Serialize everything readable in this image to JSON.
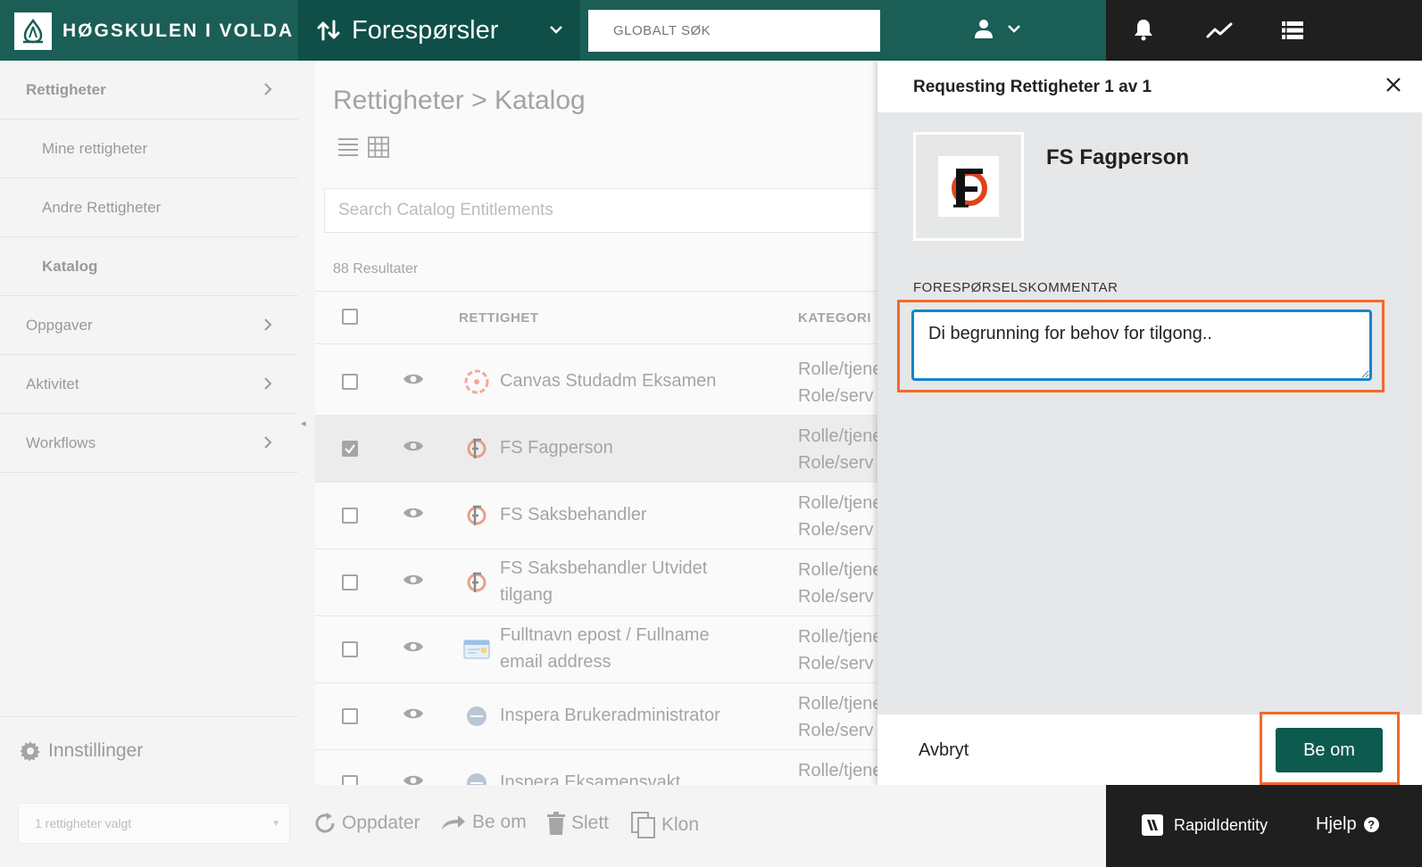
{
  "header": {
    "brand": "HØGSKULEN I VOLDA",
    "module_title": "Forespørsler",
    "global_search_placeholder": "GLOBALT SØK",
    "icons": [
      "user-icon",
      "chevron-down-icon",
      "bell-icon",
      "activity-icon",
      "list-icon"
    ]
  },
  "sidebar": {
    "items": [
      {
        "label": "Rettigheter"
      },
      {
        "label": "Mine rettigheter"
      },
      {
        "label": "Andre Rettigheter"
      },
      {
        "label": "Katalog"
      },
      {
        "label": "Oppgaver"
      },
      {
        "label": "Aktivitet"
      },
      {
        "label": "Workflows"
      }
    ],
    "settings_label": "Innstillinger"
  },
  "main": {
    "page_title": "Rettigheter > Katalog",
    "search_placeholder": "Search Catalog Entitlements",
    "results_count": "88 Resultater",
    "columns": {
      "entitlement": "RETTIGHET",
      "category": "KATEGORI"
    },
    "rows": [
      {
        "name": "Canvas Studadm Eksamen",
        "cat1": "Rolle/tjene",
        "cat2": "Role/serv",
        "checked": false,
        "icon": "canvas-icon"
      },
      {
        "name": "FS Fagperson",
        "cat1": "Rolle/tjene",
        "cat2": "Role/serv",
        "checked": true,
        "icon": "fs-logo-icon"
      },
      {
        "name": "FS Saksbehandler",
        "cat1": "Rolle/tjene",
        "cat2": "Role/serv",
        "checked": false,
        "icon": "fs-logo-icon"
      },
      {
        "name": "FS Saksbehandler Utvidet tilgang",
        "cat1": "Rolle/tjene",
        "cat2": "Role/serv",
        "checked": false,
        "icon": "fs-logo-icon"
      },
      {
        "name": "Fulltnavn epost / Fullname email address",
        "cat1": "Rolle/tjene",
        "cat2": "Role/serv",
        "checked": false,
        "icon": "email-card-icon"
      },
      {
        "name": "Inspera Brukeradministrator",
        "cat1": "Rolle/tjene",
        "cat2": "Role/serv",
        "checked": false,
        "icon": "inspera-icon"
      },
      {
        "name": "Inspera Eksamensvakt",
        "cat1": "Rolle/tjene",
        "cat2": "",
        "checked": false,
        "icon": "inspera-icon"
      }
    ]
  },
  "panel": {
    "title": "Requesting Rettigheter 1 av 1",
    "entitlement_name": "FS Fagperson",
    "comment_label": "FORESPØRSELSKOMMENTAR",
    "comment_value": "Di begrunning for behov for tilgong..",
    "cancel_label": "Avbryt",
    "submit_label": "Be om"
  },
  "bottom": {
    "bulk_select": "1 rettigheter valgt",
    "actions": {
      "refresh": "Oppdater",
      "request": "Be om",
      "delete": "Slett",
      "clone": "Klon"
    },
    "brand": "RapidIdentity",
    "help": "Hjelp"
  },
  "colors": {
    "header_green": "#1a5e55",
    "module_green": "#0f4f47",
    "accent_orange": "#f26a2a",
    "focus_blue": "#1585c9",
    "button_green": "#0d5a4f"
  }
}
